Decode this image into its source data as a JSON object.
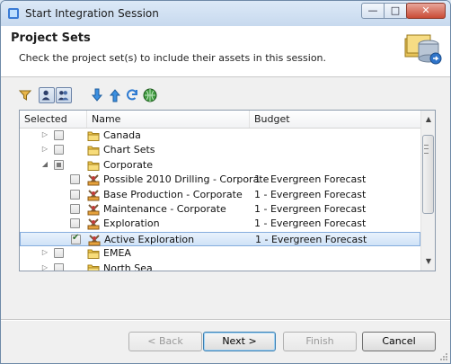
{
  "window": {
    "title": "Start Integration Session",
    "minimize": "—",
    "maximize": "□",
    "close": "✕"
  },
  "header": {
    "title": "Project Sets",
    "description": "Check the project set(s) to include their assets in this session."
  },
  "toolbar": {
    "icons": [
      "filter-icon",
      "users-view-icon",
      "group-view-icon",
      "move-down-icon",
      "move-up-icon",
      "refresh-icon",
      "globe-icon"
    ]
  },
  "tree": {
    "columns": [
      "Selected",
      "Name",
      "Budget"
    ],
    "rows": [
      {
        "name": "Canada",
        "budget": "",
        "type": "folder",
        "expander": "▷",
        "check": "none"
      },
      {
        "name": "Chart Sets",
        "budget": "",
        "type": "folder",
        "expander": "▷",
        "check": "none"
      },
      {
        "name": "Corporate",
        "budget": "",
        "type": "folder",
        "expander": "◢",
        "check": "partial"
      },
      {
        "name": "Possible 2010 Drilling - Corporate",
        "budget": "1 - Evergreen Forecast",
        "type": "project",
        "expander": "",
        "check": "none"
      },
      {
        "name": "Base Production - Corporate",
        "budget": "1 - Evergreen Forecast",
        "type": "project",
        "expander": "",
        "check": "none"
      },
      {
        "name": "Maintenance - Corporate",
        "budget": "1 - Evergreen Forecast",
        "type": "project",
        "expander": "",
        "check": "none"
      },
      {
        "name": "Exploration",
        "budget": "1 - Evergreen Forecast",
        "type": "project",
        "expander": "",
        "check": "none"
      },
      {
        "name": "Active Exploration",
        "budget": "1 - Evergreen Forecast",
        "type": "project",
        "expander": "",
        "check": "checked",
        "selected": true
      },
      {
        "name": "EMEA",
        "budget": "",
        "type": "folder",
        "expander": "▷",
        "check": "none"
      },
      {
        "name": "North Sea",
        "budget": "",
        "type": "folder",
        "expander": "▷",
        "check": "none"
      }
    ]
  },
  "buttons": {
    "back": "< Back",
    "next": "Next >",
    "finish": "Finish",
    "cancel": "Cancel"
  },
  "colors": {
    "selection": "#cfe2f7",
    "folder": "#f2c94c",
    "accent": "#3c7fb1"
  }
}
